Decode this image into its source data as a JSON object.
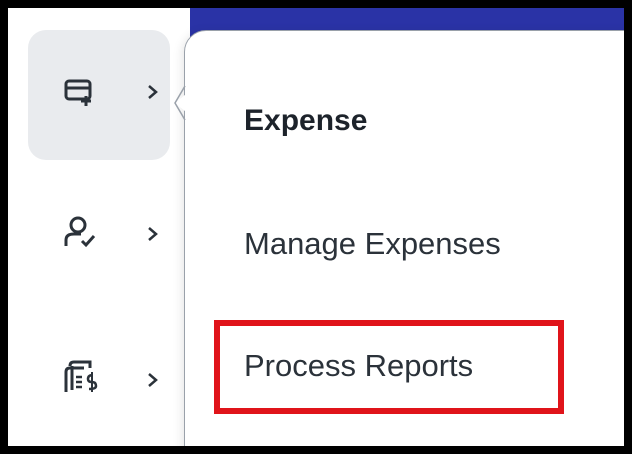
{
  "app": {
    "accent_color": "#2a33a6",
    "highlight_color": "#e0141a"
  },
  "sidebar": {
    "items": [
      {
        "icon": "expense-card-add-icon",
        "active": true
      },
      {
        "icon": "user-check-icon",
        "active": false
      },
      {
        "icon": "receipt-dollar-icon",
        "active": false
      }
    ]
  },
  "flyout": {
    "heading": "Expense",
    "items": [
      {
        "label": "Manage Expenses"
      },
      {
        "label": "Process Reports",
        "highlighted": true
      }
    ]
  }
}
